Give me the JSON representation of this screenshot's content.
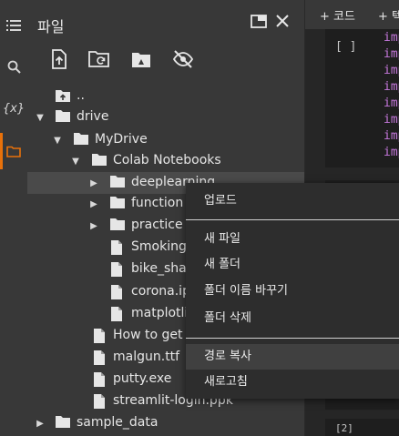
{
  "panel": {
    "title": "파일",
    "toolbar": [
      "upload-icon",
      "refresh-folder-icon",
      "drive-folder-icon",
      "hide-icon"
    ]
  },
  "rail": [
    "menu-icon",
    "search-icon",
    "variables-icon",
    "folder-icon"
  ],
  "rail_variables_label": "{x}",
  "tree": [
    {
      "label": "..",
      "kind": "up"
    },
    {
      "label": "drive",
      "kind": "folder",
      "open": true
    },
    {
      "label": "MyDrive",
      "kind": "folder",
      "open": true
    },
    {
      "label": "Colab Notebooks",
      "kind": "folder",
      "open": true
    },
    {
      "label": "deeplearning",
      "kind": "folder",
      "open": false
    },
    {
      "label": "function",
      "kind": "folder",
      "open": false
    },
    {
      "label": "practice",
      "kind": "folder",
      "open": false
    },
    {
      "label": "Smoking.",
      "kind": "file"
    },
    {
      "label": "bike_shar",
      "kind": "file"
    },
    {
      "label": "corona.ipy",
      "kind": "file"
    },
    {
      "label": "matplotlib",
      "kind": "file"
    },
    {
      "label": "How to get s",
      "kind": "file"
    },
    {
      "label": "malgun.ttf",
      "kind": "file"
    },
    {
      "label": "putty.exe",
      "kind": "file"
    },
    {
      "label": "streamlit-login.ppk",
      "kind": "file"
    },
    {
      "label": "sample_data",
      "kind": "folder",
      "open": false
    }
  ],
  "context_menu": {
    "upload": "업로드",
    "new_file": "새 파일",
    "new_folder": "새 폴더",
    "rename_folder": "폴더 이름 바꾸기",
    "delete_folder": "폴더 삭제",
    "copy_path": "경로 복사",
    "refresh": "새로고침"
  },
  "notebook": {
    "add_code": "+ 코드",
    "add_text": "+ 텍",
    "cell_bracket": "[ ]",
    "code_prefix": "imp",
    "cell3_bracket": "[2]"
  },
  "colors": {
    "accent": "#e8710a",
    "keyword": "#c678dd"
  }
}
